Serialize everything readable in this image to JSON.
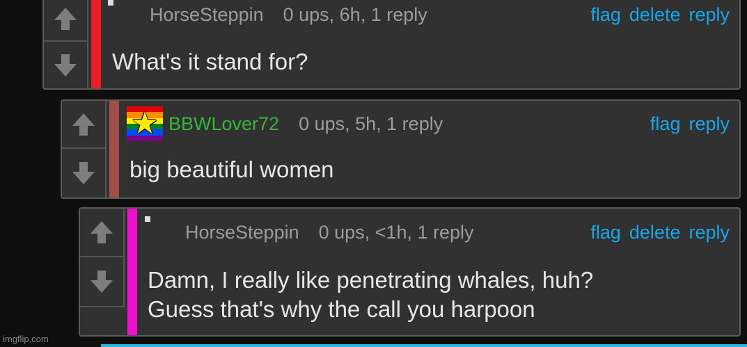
{
  "comments": [
    {
      "user": "HorseSteppin",
      "meta": "0 ups, 6h, 1 reply",
      "text": "What's it stand for?",
      "actions": [
        "flag",
        "delete",
        "reply"
      ],
      "bar_color": "#ee1c24"
    },
    {
      "user": "BBWLover72",
      "meta": "0 ups, 5h, 1 reply",
      "text": "big beautiful women",
      "actions": [
        "flag",
        "reply"
      ],
      "bar_color": "#a24f4a",
      "user_color": "#35b53b",
      "avatar_icon": "rainbow-star-icon"
    },
    {
      "user": "HorseSteppin",
      "meta": "0 ups, <1h, 1 reply",
      "text_lines": [
        "Damn, I really like penetrating whales, huh?",
        "Guess that's why the call you harpoon"
      ],
      "actions": [
        "flag",
        "delete",
        "reply"
      ],
      "bar_color": "#ee11cc"
    }
  ],
  "watermark": "imgflip.com",
  "colors": {
    "link": "#19a6e6",
    "background": "#0e0e0e",
    "card": "#313131"
  }
}
